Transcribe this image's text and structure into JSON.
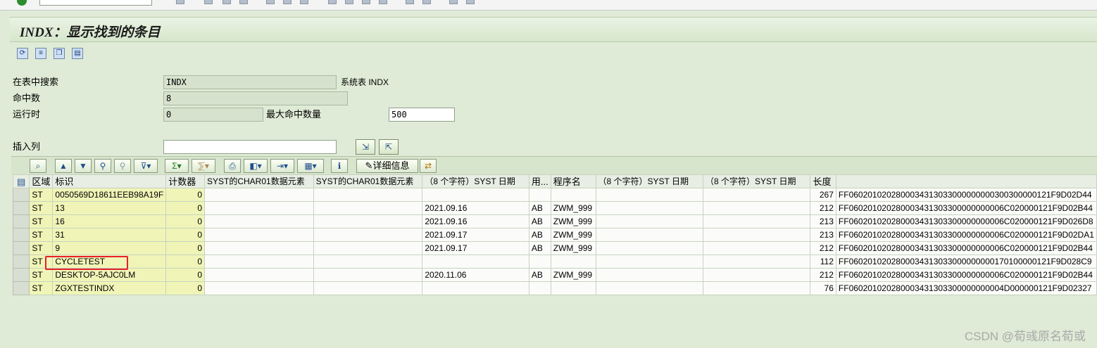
{
  "title": "INDX：显示找到的条目",
  "toolbar_icons": [
    "refresh-icon",
    "filter-icon",
    "copy-icon",
    "document-icon"
  ],
  "form": {
    "search_table_label": "在表中搜索",
    "search_table_value": "INDX",
    "search_table_desc": "系统表 INDX",
    "hits_label": "命中数",
    "hits_value": "8",
    "runtime_label": "运行时",
    "runtime_value": "0",
    "max_hits_label": "最大命中数量",
    "max_hits_value": "500",
    "insert_col_label": "插入列",
    "insert_col_value": ""
  },
  "alv_toolbar": {
    "details_label": "详细信息"
  },
  "table": {
    "columns": [
      "区域",
      "标识",
      "计数器",
      "SYST的CHAR01数据元素",
      "SYST的CHAR01数据元素",
      "（8 个字符）SYST 日期",
      "用...",
      "程序名",
      "（8 个字符）SYST 日期",
      "（8 个字符）SYST 日期",
      "长度",
      ""
    ],
    "rows": [
      [
        "ST",
        "0050569D18611EEB98A19F",
        "0",
        "",
        "",
        "",
        "",
        "",
        "",
        "",
        "267",
        "FF0602010202800034313033000000000300300000121F9D02D44"
      ],
      [
        "ST",
        "13",
        "0",
        "",
        "",
        "2021.09.16",
        "AB",
        "ZWM_999",
        "",
        "",
        "212",
        "FF060201020280003431303300000000006C020000121F9D02B44"
      ],
      [
        "ST",
        "16",
        "0",
        "",
        "",
        "2021.09.16",
        "AB",
        "ZWM_999",
        "",
        "",
        "213",
        "FF060201020280003431303300000000006C020000121F9D026D8"
      ],
      [
        "ST",
        "31",
        "0",
        "",
        "",
        "2021.09.17",
        "AB",
        "ZWM_999",
        "",
        "",
        "213",
        "FF060201020280003431303300000000006C020000121F9D02DA1"
      ],
      [
        "ST",
        "9",
        "0",
        "",
        "",
        "2021.09.17",
        "AB",
        "ZWM_999",
        "",
        "",
        "212",
        "FF060201020280003431303300000000006C020000121F9D02B44"
      ],
      [
        "ST",
        "CYCLETEST",
        "0",
        "",
        "",
        "",
        "",
        "",
        "",
        "",
        "112",
        "FF0602010202800034313033000000000170100000121F9D028C9"
      ],
      [
        "ST",
        "DESKTOP-5AJC0LM",
        "0",
        "",
        "",
        "2020.11.06",
        "AB",
        "ZWM_999",
        "",
        "",
        "212",
        "FF060201020280003431303300000000006C020000121F9D02B44"
      ],
      [
        "ST",
        "ZGXTESTINDX",
        "0",
        "",
        "",
        "",
        "",
        "",
        "",
        "",
        "76",
        "FF060201020280003431303300000000004D000000121F9D02327"
      ]
    ]
  },
  "watermark": "CSDN @荀彧原名荀或"
}
